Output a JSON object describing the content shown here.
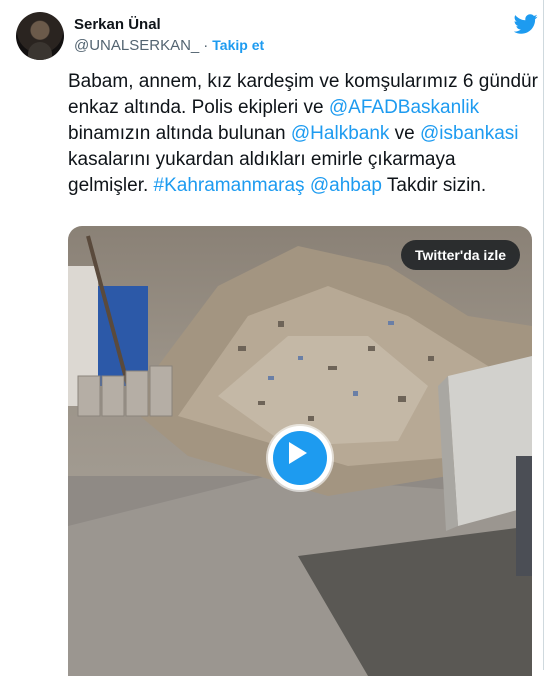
{
  "author": {
    "name": "Serkan Ünal",
    "handle": "@UNALSERKAN_",
    "separator": "·",
    "follow_label": "Takip et"
  },
  "icons": {
    "avatar": "user-avatar",
    "brand": "twitter-bird-icon",
    "play": "play-icon"
  },
  "tweet": {
    "t1": "Babam, annem, kız kardeşim ve komşularımız 6 gündür enkaz altında. Polis ekipleri ve ",
    "mention_afad": "@AFADBaskanlik",
    "t2": " binamızın altında bulunan ",
    "mention_halkbank": "@Halkbank",
    "t3": " ve ",
    "mention_isbank": "@isbankasi",
    "t4": " kasalarını yukardan aldıkları emirle çıkarmaya gelmişler. ",
    "hashtag": "#Kahramanmaraş",
    "t5": " ",
    "mention_ahbap": "@ahbap",
    "t6": " Takdir sizin."
  },
  "media": {
    "watch_label": "Twitter'da izle"
  },
  "colors": {
    "link": "#1d9bf0",
    "text": "#0f1419",
    "secondary": "#536471"
  }
}
